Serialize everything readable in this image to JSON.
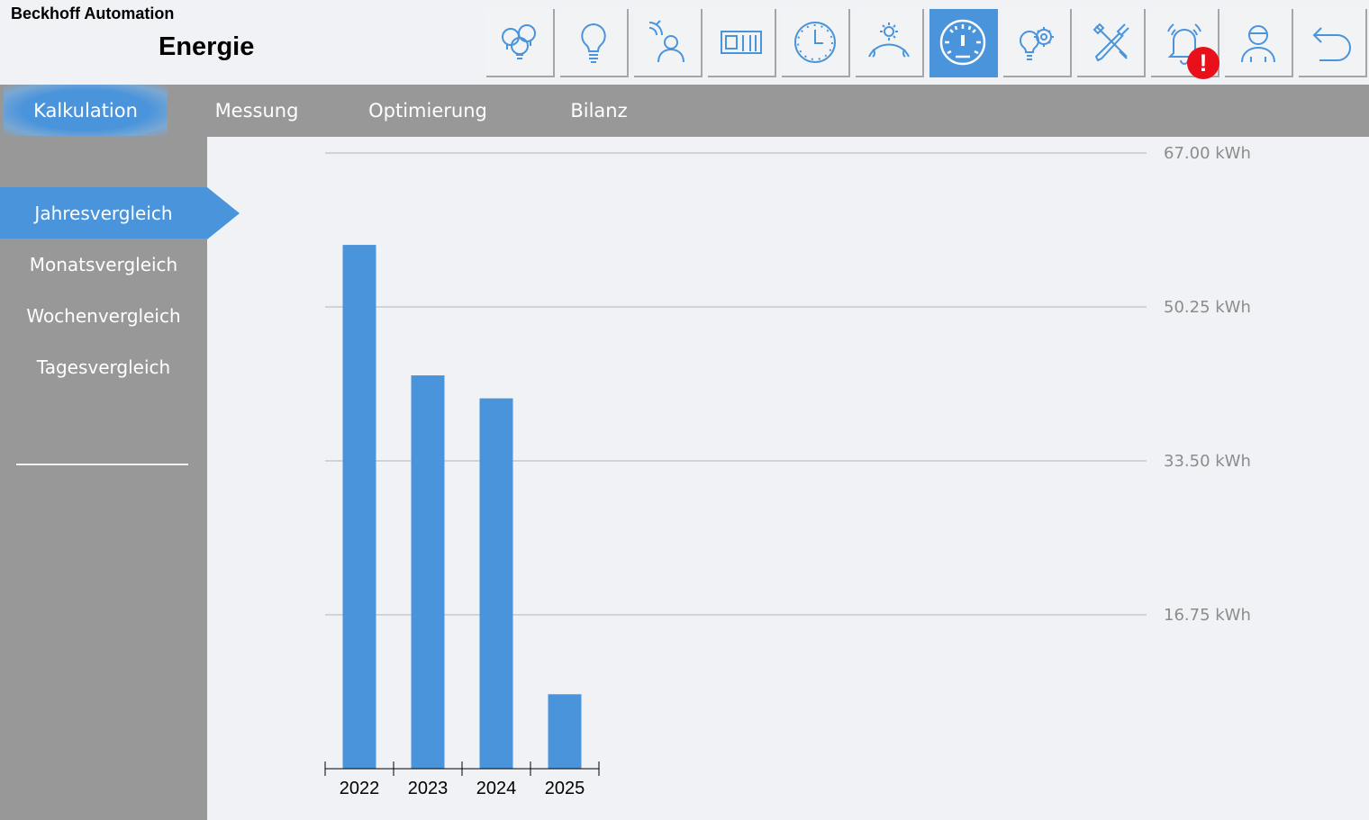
{
  "header": {
    "brand": "Beckhoff Automation",
    "title": "Energie"
  },
  "toolbar": {
    "buttons": [
      {
        "name": "lights-group-icon"
      },
      {
        "name": "lightbulb-icon"
      },
      {
        "name": "presence-sensor-icon"
      },
      {
        "name": "blinds-icon"
      },
      {
        "name": "clock-icon"
      },
      {
        "name": "weather-icon"
      },
      {
        "name": "energy-gauge-icon",
        "active": true
      },
      {
        "name": "scene-settings-icon"
      },
      {
        "name": "service-tools-icon"
      },
      {
        "name": "alarm-bell-icon",
        "badge": "!"
      },
      {
        "name": "user-icon"
      },
      {
        "name": "back-icon"
      }
    ],
    "accent_color": "#4a94dc",
    "alarm_badge_color": "#e8101a"
  },
  "tabs": [
    {
      "label": "Kalkulation",
      "active": true
    },
    {
      "label": "Messung"
    },
    {
      "label": "Optimierung"
    },
    {
      "label": "Bilanz"
    }
  ],
  "sidebar": {
    "items": [
      {
        "label": "Jahresvergleich",
        "active": true
      },
      {
        "label": "Monatsvergleich"
      },
      {
        "label": "Wochenvergleich"
      },
      {
        "label": "Tagesvergleich"
      }
    ]
  },
  "chart_data": {
    "type": "bar",
    "categories": [
      "2022",
      "2023",
      "2024",
      "2025"
    ],
    "values": [
      57.0,
      42.8,
      40.3,
      8.1
    ],
    "ylim": [
      0,
      67
    ],
    "yticks": [
      "16.75 kWh",
      "33.50 kWh",
      "50.25 kWh",
      "67.00 kWh"
    ],
    "ytick_values": [
      16.75,
      33.5,
      50.25,
      67
    ],
    "grid": true,
    "bar_color": "#4a94dc"
  }
}
